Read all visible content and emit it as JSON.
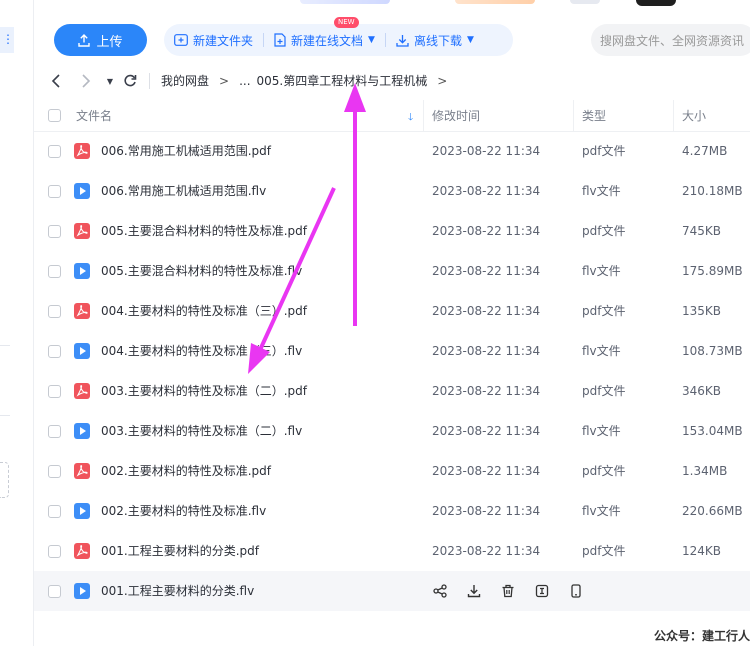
{
  "toolbar": {
    "upload_label": "上传",
    "new_folder_label": "新建文件夹",
    "new_online_doc_label": "新建在线文档",
    "new_badge": "NEW",
    "offline_download_label": "离线下载",
    "search_placeholder": "搜网盘文件、全网资源资讯"
  },
  "breadcrumb": {
    "root": "我的网盘",
    "ellipsis": "...",
    "current": "005.第四章工程材料与工程机械",
    "separator": ">"
  },
  "table": {
    "columns": {
      "name": "文件名",
      "modified": "修改时间",
      "type": "类型",
      "size": "大小"
    },
    "rows": [
      {
        "name": "006.常用施工机械适用范围.pdf",
        "modified": "2023-08-22 11:34",
        "type": "pdf文件",
        "size": "4.27MB",
        "kind": "pdf"
      },
      {
        "name": "006.常用施工机械适用范围.flv",
        "modified": "2023-08-22 11:34",
        "type": "flv文件",
        "size": "210.18MB",
        "kind": "flv"
      },
      {
        "name": "005.主要混合料材料的特性及标准.pdf",
        "modified": "2023-08-22 11:34",
        "type": "pdf文件",
        "size": "745KB",
        "kind": "pdf"
      },
      {
        "name": "005.主要混合料材料的特性及标准.flv",
        "modified": "2023-08-22 11:34",
        "type": "flv文件",
        "size": "175.89MB",
        "kind": "flv"
      },
      {
        "name": "004.主要材料的特性及标准（三）.pdf",
        "modified": "2023-08-22 11:34",
        "type": "pdf文件",
        "size": "135KB",
        "kind": "pdf"
      },
      {
        "name": "004.主要材料的特性及标准（三）.flv",
        "modified": "2023-08-22 11:34",
        "type": "flv文件",
        "size": "108.73MB",
        "kind": "flv"
      },
      {
        "name": "003.主要材料的特性及标准（二）.pdf",
        "modified": "2023-08-22 11:34",
        "type": "pdf文件",
        "size": "346KB",
        "kind": "pdf"
      },
      {
        "name": "003.主要材料的特性及标准（二）.flv",
        "modified": "2023-08-22 11:34",
        "type": "flv文件",
        "size": "153.04MB",
        "kind": "flv"
      },
      {
        "name": "002.主要材料的特性及标准.pdf",
        "modified": "2023-08-22 11:34",
        "type": "pdf文件",
        "size": "1.34MB",
        "kind": "pdf"
      },
      {
        "name": "002.主要材料的特性及标准.flv",
        "modified": "2023-08-22 11:34",
        "type": "flv文件",
        "size": "220.66MB",
        "kind": "flv"
      },
      {
        "name": "001.工程主要材料的分类.pdf",
        "modified": "2023-08-22 11:34",
        "type": "pdf文件",
        "size": "124KB",
        "kind": "pdf"
      },
      {
        "name": "001.工程主要材料的分类.flv",
        "kind": "flv",
        "hovered": true
      }
    ]
  },
  "row_actions": [
    "share-icon",
    "download-icon",
    "delete-icon",
    "rename-icon",
    "phone-icon"
  ],
  "colors": {
    "accent": "#2b86f9",
    "pdf": "#f0545c",
    "flv": "#3d8ef7",
    "arrow": "#e936f2"
  },
  "watermark": "公众号：建工行人"
}
